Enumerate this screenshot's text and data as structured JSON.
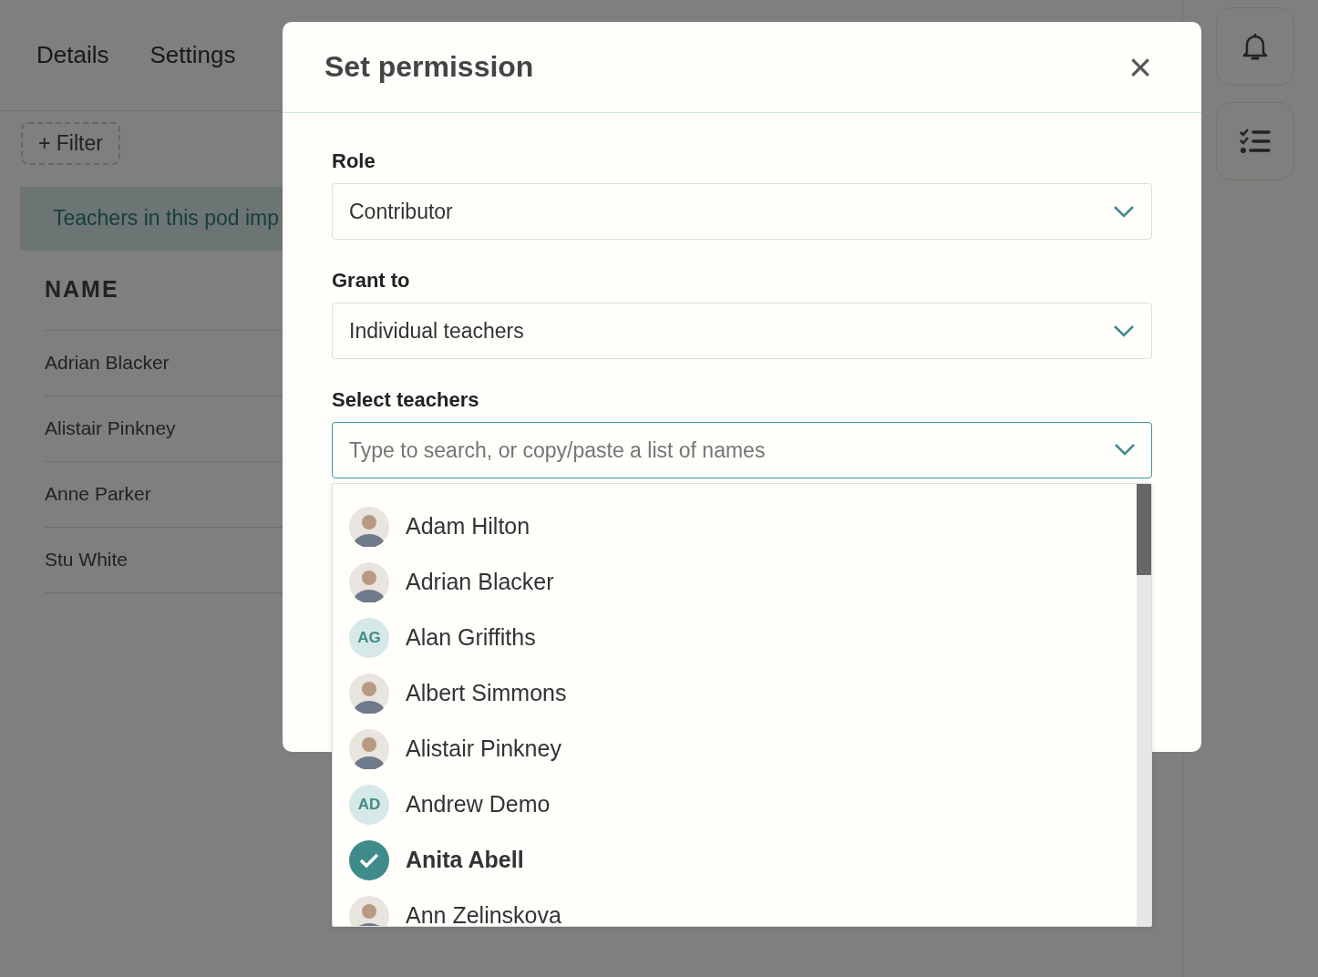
{
  "page": {
    "tabs": [
      {
        "label": "Details"
      },
      {
        "label": "Settings"
      }
    ],
    "filter_button": "+ Filter",
    "banner": "Teachers in this pod imp",
    "table": {
      "columns": [
        "NAME"
      ],
      "rows": [
        {
          "name": "Adrian Blacker"
        },
        {
          "name": "Alistair Pinkney"
        },
        {
          "name": "Anne Parker"
        },
        {
          "name": "Stu White"
        }
      ]
    }
  },
  "modal": {
    "title": "Set permission",
    "close": "×",
    "fields": [
      {
        "label": "Role",
        "value": "Contributor"
      },
      {
        "label": "Grant to",
        "value": "Individual teachers"
      },
      {
        "label": "Select teachers",
        "placeholder": "Type to search, or copy/paste a list of names"
      }
    ],
    "options": [
      {
        "name": "Adam Hilton",
        "kind": "photo",
        "selected": false
      },
      {
        "name": "Adrian Blacker",
        "kind": "photo",
        "selected": false
      },
      {
        "name": "Alan Griffiths",
        "kind": "initials",
        "initials": "AG",
        "selected": false
      },
      {
        "name": "Albert Simmons",
        "kind": "photo",
        "selected": false
      },
      {
        "name": "Alistair Pinkney",
        "kind": "photo",
        "selected": false
      },
      {
        "name": "Andrew Demo",
        "kind": "initials",
        "initials": "AD",
        "selected": false
      },
      {
        "name": "Anita Abell",
        "kind": "check",
        "selected": true
      },
      {
        "name": "Ann Zelinskova",
        "kind": "photo",
        "selected": false
      }
    ]
  }
}
